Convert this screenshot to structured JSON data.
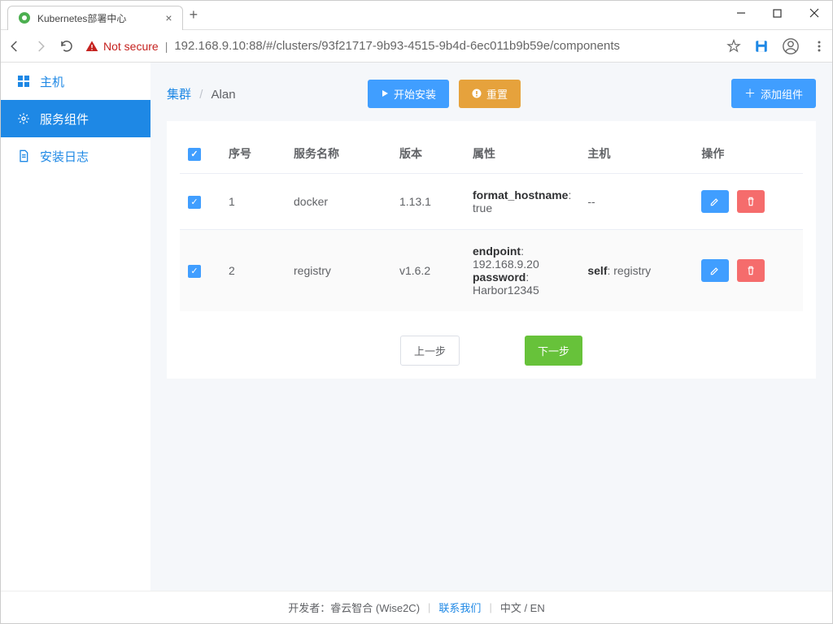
{
  "browser": {
    "tab_title": "Kubernetes部署中心",
    "not_secure": "Not secure",
    "url": "192.168.9.10:88/#/clusters/93f21717-9b93-4515-9b4d-6ec011b9b59e/components"
  },
  "sidebar": {
    "items": [
      {
        "label": "主机"
      },
      {
        "label": "服务组件"
      },
      {
        "label": "安装日志"
      }
    ]
  },
  "breadcrumb": {
    "root": "集群",
    "current": "Alan"
  },
  "actions": {
    "start_install": "开始安装",
    "reset": "重置",
    "add_component": "添加组件"
  },
  "table": {
    "headers": {
      "index": "序号",
      "name": "服务名称",
      "version": "版本",
      "props": "属性",
      "host": "主机",
      "ops": "操作"
    },
    "rows": [
      {
        "index": "1",
        "name": "docker",
        "version": "1.13.1",
        "props_html": "<b>format_hostname</b>: true",
        "host": "--"
      },
      {
        "index": "2",
        "name": "registry",
        "version": "v1.6.2",
        "props_html": "<b>endpoint</b>: 192.168.9.20<br><b>password</b>: Harbor12345",
        "host_html": "<b>self</b>: registry"
      }
    ]
  },
  "pager": {
    "prev": "上一步",
    "next": "下一步"
  },
  "footer": {
    "dev": "开发者：睿云智合 (Wise2C)",
    "contact": "联系我们",
    "lang": "中文 / EN"
  }
}
